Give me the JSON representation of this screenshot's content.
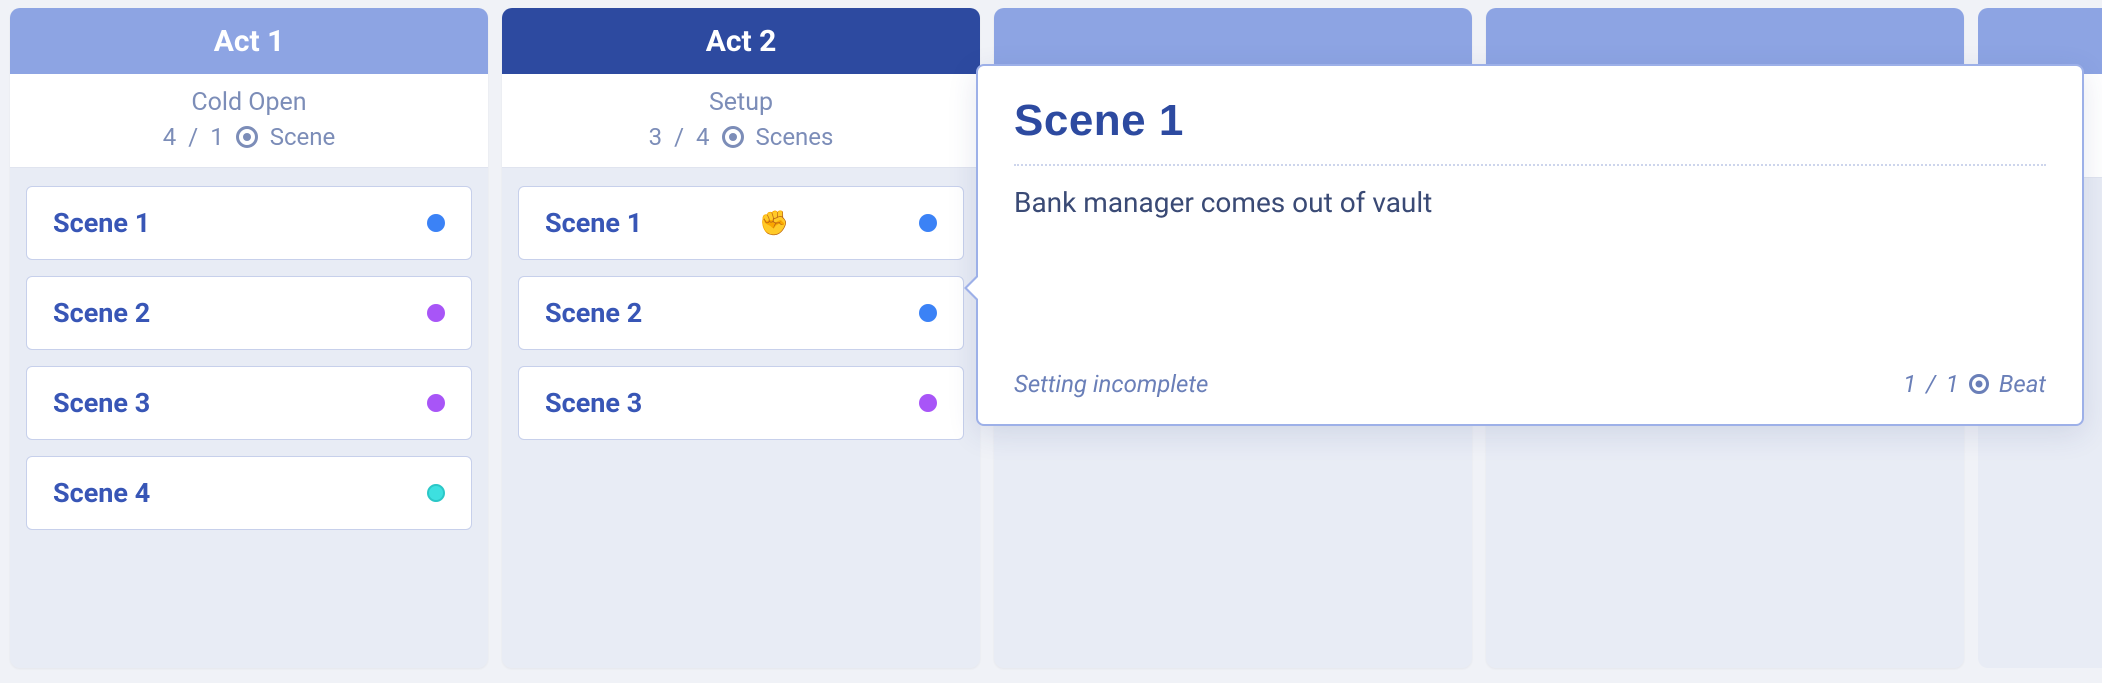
{
  "columns": [
    {
      "title": "Act 1",
      "subtitle": "Cold Open",
      "count_current": "4",
      "count_target": "1",
      "unit": "Scene",
      "header_style": "light",
      "scenes": [
        {
          "label": "Scene 1",
          "dot": "blue"
        },
        {
          "label": "Scene 2",
          "dot": "purple"
        },
        {
          "label": "Scene 3",
          "dot": "purple"
        },
        {
          "label": "Scene 4",
          "dot": "cyan"
        }
      ]
    },
    {
      "title": "Act 2",
      "subtitle": "Setup",
      "count_current": "3",
      "count_target": "4",
      "unit": "Scenes",
      "header_style": "dark",
      "scenes": [
        {
          "label": "Scene 1",
          "dot": "blue",
          "hover": true
        },
        {
          "label": "Scene 2",
          "dot": "blue"
        },
        {
          "label": "Scene 3",
          "dot": "purple"
        }
      ]
    }
  ],
  "bg_columns": [
    {},
    {}
  ],
  "popover": {
    "title": "Scene 1",
    "body": "Bank manager comes out of vault",
    "status": "Setting incomplete",
    "beat_current": "1",
    "beat_target": "1",
    "beat_label": "Beat"
  }
}
